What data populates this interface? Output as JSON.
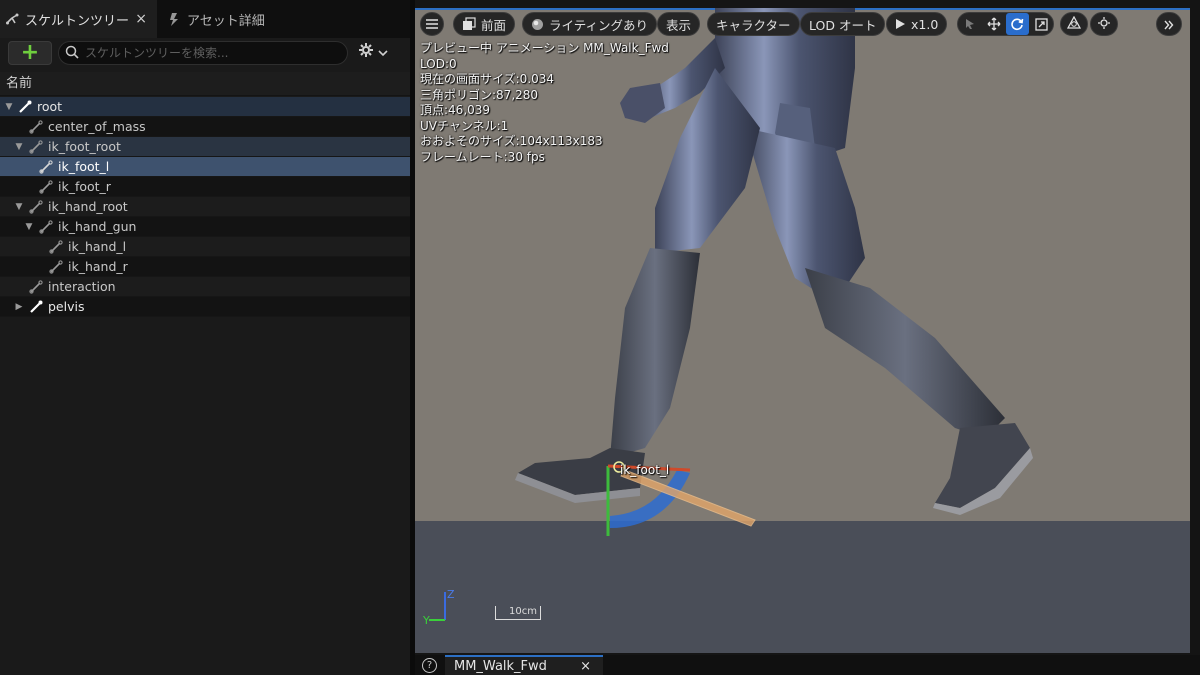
{
  "tabs": {
    "skeleton_tree": "スケルトンツリー",
    "asset_details": "アセット詳細",
    "close": "×"
  },
  "toolbar": {
    "add": "+",
    "search_placeholder": "スケルトンツリーを検索..."
  },
  "tree": {
    "column_header": "名前",
    "bones": [
      {
        "name": "root"
      },
      {
        "name": "center_of_mass"
      },
      {
        "name": "ik_foot_root"
      },
      {
        "name": "ik_foot_l"
      },
      {
        "name": "ik_foot_r"
      },
      {
        "name": "ik_hand_root"
      },
      {
        "name": "ik_hand_gun"
      },
      {
        "name": "ik_hand_l"
      },
      {
        "name": "ik_hand_r"
      },
      {
        "name": "interaction"
      },
      {
        "name": "pelvis"
      }
    ]
  },
  "viewport_toolbar": {
    "view": "前面",
    "lighting": "ライティングあり",
    "show": "表示",
    "character": "キャラクター",
    "lod": "LOD オート",
    "playback": "x1.0"
  },
  "stats": {
    "line1": "プレビュー中 アニメーション MM_Walk_Fwd",
    "line2": "LOD:0",
    "line3": "現在の画面サイズ:0.034",
    "line4": "三角ポリゴン:87,280",
    "line5": "頂点:46,039",
    "line6": "UVチャンネル:1",
    "line7": "おおよそのサイズ:104x113x183",
    "line8": "フレームレート:30 fps"
  },
  "gizmo": {
    "bone_label": "ik_foot_l"
  },
  "axes": {
    "z": "Z",
    "y": "Y",
    "scale": "10cm"
  },
  "bottom_tab": {
    "label": "MM_Walk_Fwd",
    "close": "×",
    "help": "?"
  },
  "colors": {
    "accent": "#2c6fc4",
    "selection": "#3e526e",
    "add_icon": "#6fcf3e"
  }
}
